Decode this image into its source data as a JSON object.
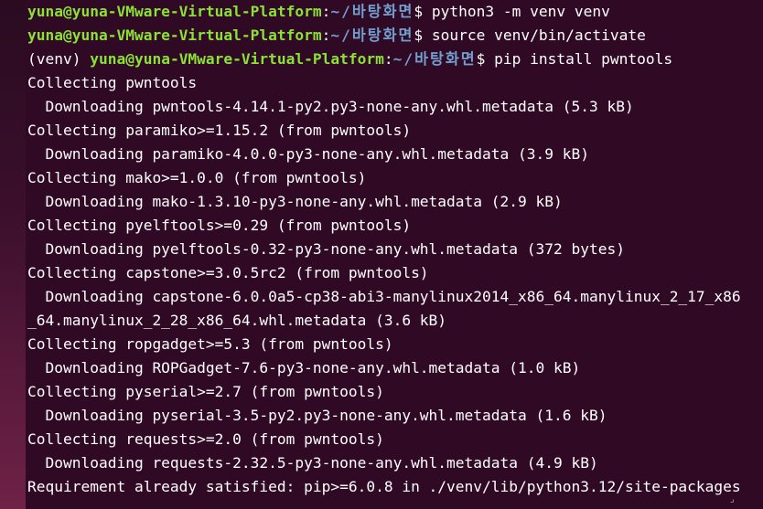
{
  "prompts": [
    {
      "prefix": "",
      "user_host": "yuna@yuna-VMware-Virtual-Platform",
      "path": "~/바탕화면",
      "command": "python3 -m venv venv"
    },
    {
      "prefix": "",
      "user_host": "yuna@yuna-VMware-Virtual-Platform",
      "path": "~/바탕화면",
      "command": "source venv/bin/activate"
    },
    {
      "prefix": "(venv) ",
      "user_host": "yuna@yuna-VMware-Virtual-Platform",
      "path": "~/바탕화면",
      "command": "pip install pwntools"
    }
  ],
  "output": [
    "Collecting pwntools",
    "  Downloading pwntools-4.14.1-py2.py3-none-any.whl.metadata (5.3 kB)",
    "Collecting paramiko>=1.15.2 (from pwntools)",
    "  Downloading paramiko-4.0.0-py3-none-any.whl.metadata (3.9 kB)",
    "Collecting mako>=1.0.0 (from pwntools)",
    "  Downloading mako-1.3.10-py3-none-any.whl.metadata (2.9 kB)",
    "Collecting pyelftools>=0.29 (from pwntools)",
    "  Downloading pyelftools-0.32-py3-none-any.whl.metadata (372 bytes)",
    "Collecting capstone>=3.0.5rc2 (from pwntools)",
    "  Downloading capstone-6.0.0a5-cp38-abi3-manylinux2014_x86_64.manylinux_2_17_x86",
    "_64.manylinux_2_28_x86_64.whl.metadata (3.6 kB)",
    "Collecting ropgadget>=5.3 (from pwntools)",
    "  Downloading ROPGadget-7.6-py3-none-any.whl.metadata (1.0 kB)",
    "Collecting pyserial>=2.7 (from pwntools)",
    "  Downloading pyserial-3.5-py2.py3-none-any.whl.metadata (1.6 kB)",
    "Collecting requests>=2.0 (from pwntools)",
    "  Downloading requests-2.32.5-py3-none-any.whl.metadata (4.9 kB)",
    "Requirement already satisfied: pip>=6.0.8 in ./venv/lib/python3.12/site-packages"
  ],
  "colors": {
    "background": "#300a24",
    "user": "#8ae234",
    "path": "#729fcf",
    "text": "#ffffff"
  }
}
